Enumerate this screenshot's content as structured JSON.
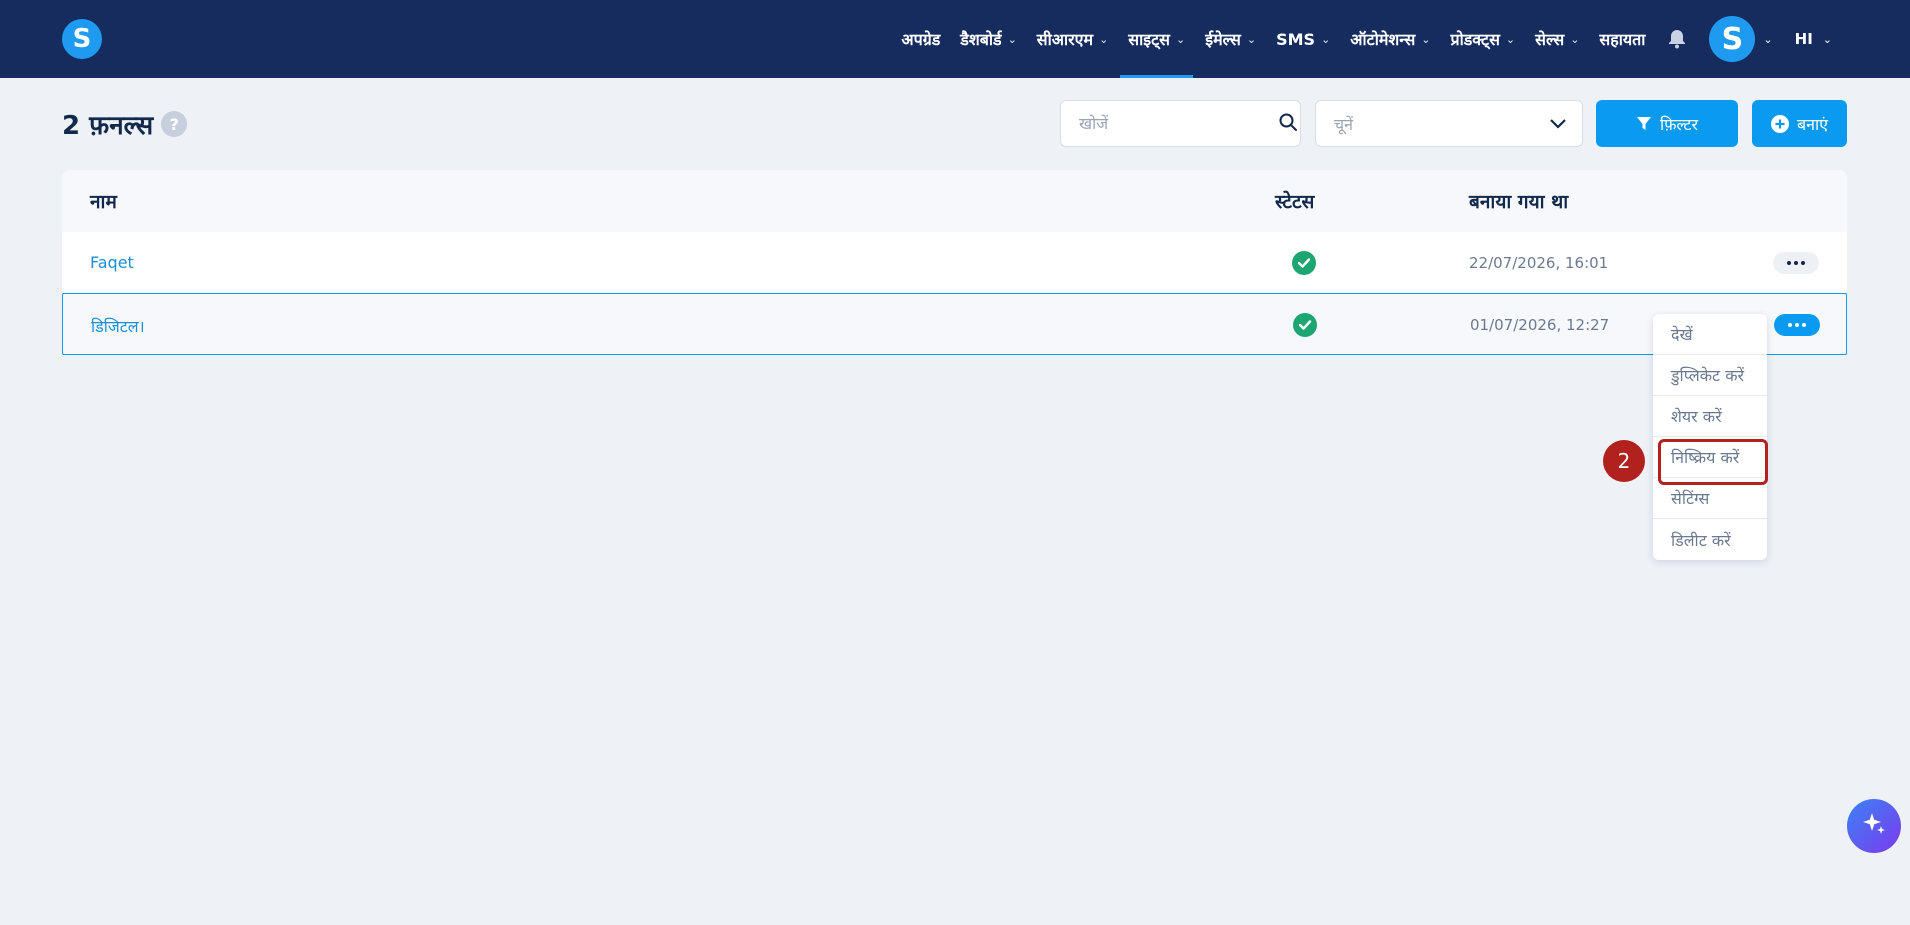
{
  "brand": {
    "logo_letter": "S"
  },
  "nav": {
    "items": [
      {
        "label": "अपग्रेड",
        "dropdown": false
      },
      {
        "label": "डैशबोर्ड",
        "dropdown": true
      },
      {
        "label": "सीआरएम",
        "dropdown": true
      },
      {
        "label": "साइट्स",
        "dropdown": true,
        "active": true
      },
      {
        "label": "ईमेल्स",
        "dropdown": true
      },
      {
        "label": "SMS",
        "dropdown": true
      },
      {
        "label": "ऑटोमेशन्स",
        "dropdown": true
      },
      {
        "label": "प्रोडक्ट्स",
        "dropdown": true
      },
      {
        "label": "सेल्स",
        "dropdown": true
      },
      {
        "label": "सहायता",
        "dropdown": false
      }
    ],
    "avatar_letter": "S",
    "language": "HI"
  },
  "header": {
    "title": "2 फ़नल्स",
    "help": "?",
    "search_placeholder": "खोजें",
    "select_placeholder": "चूनें",
    "filter_label": "फ़िल्टर",
    "create_label": "बनाएं"
  },
  "table": {
    "columns": [
      "नाम",
      "स्टेटस",
      "बनाया गया था"
    ],
    "rows": [
      {
        "name": "Faqet",
        "status": "active",
        "created": "22/07/2026, 16:01"
      },
      {
        "name": "डिजिटल।",
        "status": "active",
        "created": "01/07/2026, 12:27"
      }
    ]
  },
  "row_menu": {
    "items": [
      "देखें",
      "डुप्लिकेट करें",
      "शेयर करें",
      "निष्क्रिय करें",
      "सेटिंग्स",
      "डिलीट करें"
    ],
    "highlighted_index": 3
  },
  "annotation": {
    "step": "2",
    "color": "#b1211d"
  },
  "colors": {
    "nav_bg": "#162b5e",
    "accent": "#0a9bf0",
    "success": "#1ea672"
  }
}
